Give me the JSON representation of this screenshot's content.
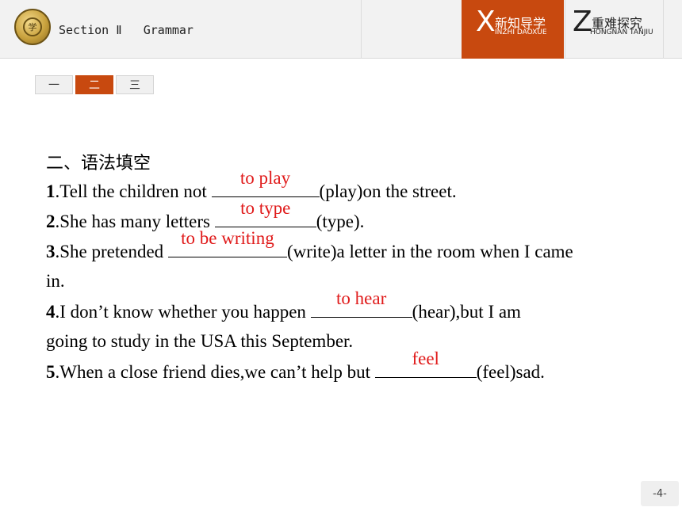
{
  "header": {
    "logo_text": "学",
    "section_title": "Section Ⅱ   Grammar",
    "nav": [
      {
        "letter": "X",
        "cn": "新知导学",
        "en": "INZHI DAOXUE"
      },
      {
        "letter": "Z",
        "cn": "重难探究",
        "en": "HONGNAN TANJIU"
      }
    ]
  },
  "tabs": [
    "一",
    "二",
    "三"
  ],
  "heading": "二、语法填空",
  "items": [
    {
      "num": "1",
      "before": ".Tell the children not ",
      "answer": "to play",
      "after": "(play)on the street."
    },
    {
      "num": "2",
      "before": ".She has many letters ",
      "answer": "to type",
      "after": "(type)."
    },
    {
      "num": "3",
      "before": ".She pretended ",
      "answer": "to be writing",
      "after": "(write)a letter in the room when I came",
      "cont": "in."
    },
    {
      "num": "4",
      "before": ".I don’t know whether you happen ",
      "answer": "to hear",
      "after": "(hear),but I am",
      "cont": "going to study in the USA this September."
    },
    {
      "num": "5",
      "before": ".When a close friend dies,we can’t help but ",
      "answer": "feel",
      "after": "(feel)sad."
    }
  ],
  "page_number": "-4-",
  "colors": {
    "accent": "#c8490f",
    "answer": "#e01a1a"
  }
}
